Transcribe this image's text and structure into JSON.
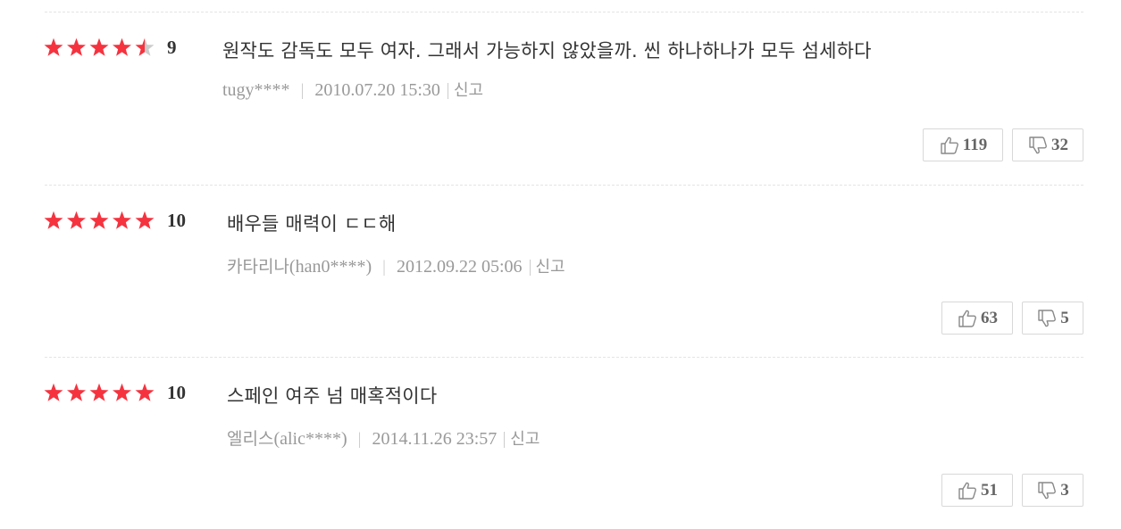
{
  "reviews": [
    {
      "rating": 4.5,
      "score": "9",
      "text": "원작도 감독도 모두 여자. 그래서 가능하지 않았을까. 씬 하나하나가 모두 섬세하다",
      "author_name": "",
      "author_id": "tugy****",
      "date": "2010.07.20 15:30",
      "report_label": "신고",
      "likes": "119",
      "dislikes": "32"
    },
    {
      "rating": 5,
      "score": "10",
      "text": "배우들 매력이 ㄷㄷ해",
      "author_name": "카타리나",
      "author_id": "(han0****)",
      "date": "2012.09.22 05:06",
      "report_label": "신고",
      "likes": "63",
      "dislikes": "5"
    },
    {
      "rating": 5,
      "score": "10",
      "text": "스페인 여주 넘 매혹적이다",
      "author_name": "엘리스",
      "author_id": "(alic****)",
      "date": "2014.11.26 23:57",
      "report_label": "신고",
      "likes": "51",
      "dislikes": "3"
    }
  ],
  "colors": {
    "star_on": "#f5333f",
    "star_off": "#cccccc",
    "meta": "#999999",
    "text": "#333333"
  },
  "icons": {
    "like": "thumbs-up-icon",
    "dislike": "thumbs-down-icon"
  }
}
